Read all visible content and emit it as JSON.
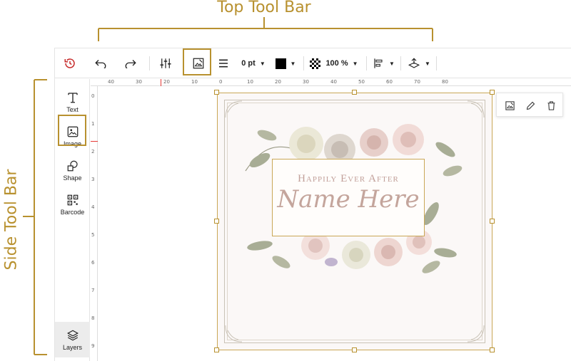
{
  "annotations": {
    "top_label": "Top Tool Bar",
    "side_label": "Side Tool Bar"
  },
  "toolbar": {
    "stroke_width": "0 pt",
    "opacity": "100 %",
    "fill_color": "#000000"
  },
  "sidebar": {
    "items": [
      {
        "label": "Text",
        "icon": "text-icon"
      },
      {
        "label": "Image",
        "icon": "image-icon"
      },
      {
        "label": "Shape",
        "icon": "shape-icon"
      },
      {
        "label": "Barcode",
        "icon": "qr-code-icon"
      }
    ],
    "layers_label": "Layers"
  },
  "ruler": {
    "h_ticks": [
      "40",
      "30",
      "20",
      "10",
      "0",
      "10",
      "20",
      "30",
      "40",
      "50",
      "60",
      "70",
      "80"
    ],
    "v_ticks": [
      "0",
      "1",
      "2",
      "3",
      "4",
      "5",
      "6",
      "7",
      "8",
      "9"
    ]
  },
  "card": {
    "eyebrow": "Happily Ever After",
    "name": "Name Here"
  },
  "colors": {
    "accent": "#b8912f",
    "selection": "#c9a756",
    "undo_history": "#c62828"
  }
}
